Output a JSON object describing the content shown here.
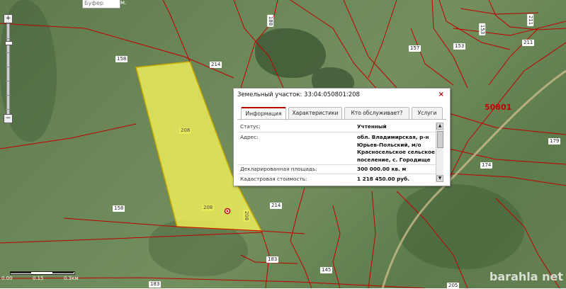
{
  "toolbar": {
    "buffer_placeholder": "Буфер",
    "buffer_unit": "м."
  },
  "zoom": {
    "plus": "+",
    "minus": "−"
  },
  "scale": {
    "labels": [
      "0.00",
      "0.15",
      "0.3км"
    ]
  },
  "map": {
    "parcel_labels": [
      "158",
      "214",
      "208",
      "208",
      "208",
      "158",
      "214",
      "183",
      "183",
      "145",
      "174",
      "179",
      "211",
      "211",
      "153",
      "153",
      "157",
      "188",
      "205"
    ],
    "block_label": "50801"
  },
  "popup": {
    "title": "Земельный участок: 33:04:050801:208",
    "close": "×",
    "tabs": [
      "Информация",
      "Характеристики",
      "Кто обслуживает?",
      "Услуги"
    ],
    "rows": [
      {
        "key": "Статус:",
        "value": "Учтенный"
      },
      {
        "key": "Адрес:",
        "value": "обл. Владимирская, р-н Юрьев-Польский, м/о Красносельское сельское поселение, с. Городище"
      },
      {
        "key": "Декларированная площадь:",
        "value": "300 000.00 кв. м"
      },
      {
        "key": "Кадастровая стоимость:",
        "value": "1 218 450.00 руб."
      }
    ]
  },
  "watermark": "barahla net",
  "colors": {
    "parcel_fill": "#e6e85a",
    "boundary": "#c00000",
    "tab_accent": "#c00000"
  }
}
